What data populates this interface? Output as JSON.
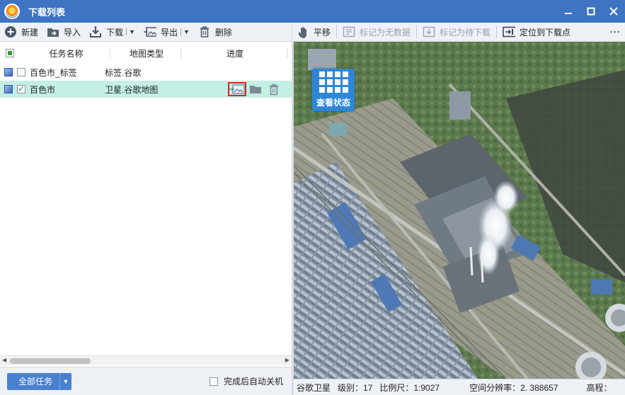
{
  "window": {
    "title": "下载列表",
    "controls": [
      "minimize-icon",
      "maximize-icon",
      "close-icon"
    ]
  },
  "left_toolbar": {
    "new_label": "新建",
    "import_label": "导入",
    "download_label": "下载",
    "export_label": "导出",
    "delete_label": "删除"
  },
  "right_toolbar": {
    "pan_label": "平移",
    "mark_no_data_label": "标记为无数据",
    "mark_pending_label": "标记为待下载",
    "locate_label": "定位到下载点",
    "more_label": "···"
  },
  "grid": {
    "columns": {
      "name": "任务名称",
      "type": "地图类型",
      "progress": "进度"
    },
    "rows": [
      {
        "name": "百色市_标签",
        "type": "标签.谷歌",
        "checked": false,
        "selected": false
      },
      {
        "name": "百色市",
        "type": "卫星.谷歌地图",
        "checked": true,
        "selected": true
      }
    ]
  },
  "bottom": {
    "all_tasks_label": "全部任务",
    "auto_shutdown_label": "完成后自动关机"
  },
  "map": {
    "status_tile_label": "查看状态",
    "status_bar": {
      "source": "谷歌卫星",
      "level": "级别：17",
      "scale": "比例尺：1:9027",
      "resolution": "空间分辨率：2. 388657",
      "elevation": "高程："
    }
  },
  "colors": {
    "title_bar": "#3f74c3",
    "selected_row": "#c3efe5",
    "highlight_border": "#e0241c",
    "status_tile": "#2f86d6"
  }
}
